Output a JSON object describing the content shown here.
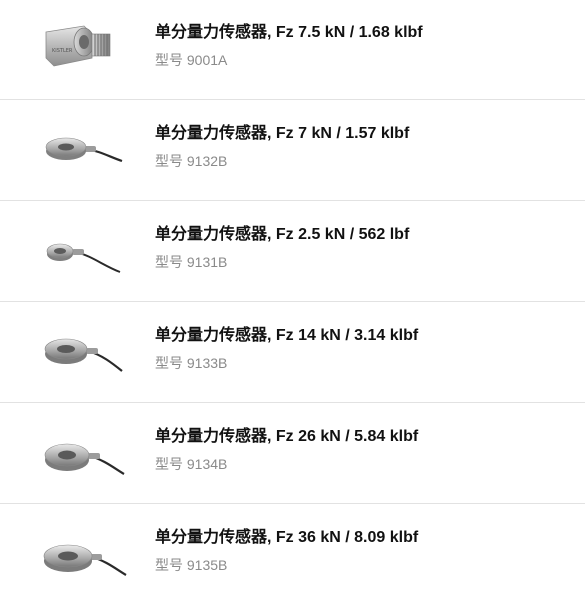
{
  "products": [
    {
      "title": "单分量力传感器, Fz 7.5 kN / 1.68 klbf",
      "model": "型号 9001A",
      "image": "threaded-stud-force-sensor"
    },
    {
      "title": "单分量力传感器, Fz 7 kN / 1.57 klbf",
      "model": "型号 9132B",
      "image": "ring-force-sensor-with-cable"
    },
    {
      "title": "单分量力传感器, Fz 2.5 kN / 562 lbf",
      "model": "型号 9131B",
      "image": "ring-force-sensor-with-cable"
    },
    {
      "title": "单分量力传感器, Fz 14 kN / 3.14 klbf",
      "model": "型号 9133B",
      "image": "ring-force-sensor-with-cable"
    },
    {
      "title": "单分量力传感器, Fz 26 kN / 5.84 klbf",
      "model": "型号 9134B",
      "image": "ring-force-sensor-with-cable"
    },
    {
      "title": "单分量力传感器, Fz 36 kN / 8.09 klbf",
      "model": "型号 9135B",
      "image": "ring-force-sensor-with-cable"
    }
  ]
}
